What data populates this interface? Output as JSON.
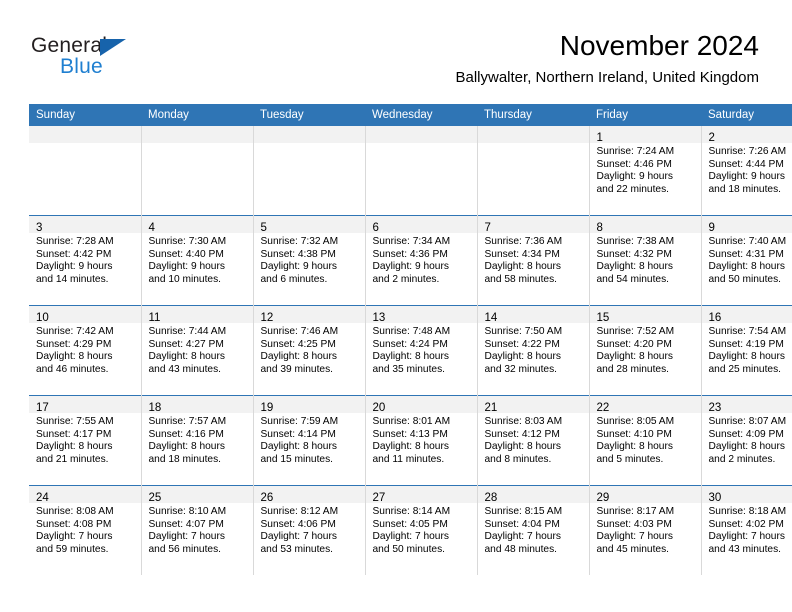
{
  "brand": {
    "name_part1": "General",
    "name_part2": "Blue",
    "accent_color": "#1f7fd0",
    "triangle_color": "#1763ab",
    "logo_icon": "blue-triangle-icon"
  },
  "header": {
    "title": "November 2024",
    "subtitle": "Ballywalter, Northern Ireland, United Kingdom"
  },
  "calendar": {
    "header_bg": "#2f75b5",
    "daynum_band_bg": "#f2f2f2",
    "weekdays": [
      "Sunday",
      "Monday",
      "Tuesday",
      "Wednesday",
      "Thursday",
      "Friday",
      "Saturday"
    ],
    "weeks": [
      [
        {
          "day": "",
          "lines": []
        },
        {
          "day": "",
          "lines": []
        },
        {
          "day": "",
          "lines": []
        },
        {
          "day": "",
          "lines": []
        },
        {
          "day": "",
          "lines": []
        },
        {
          "day": "1",
          "lines": [
            "Sunrise: 7:24 AM",
            "Sunset: 4:46 PM",
            "Daylight: 9 hours",
            "and 22 minutes."
          ]
        },
        {
          "day": "2",
          "lines": [
            "Sunrise: 7:26 AM",
            "Sunset: 4:44 PM",
            "Daylight: 9 hours",
            "and 18 minutes."
          ]
        }
      ],
      [
        {
          "day": "3",
          "lines": [
            "Sunrise: 7:28 AM",
            "Sunset: 4:42 PM",
            "Daylight: 9 hours",
            "and 14 minutes."
          ]
        },
        {
          "day": "4",
          "lines": [
            "Sunrise: 7:30 AM",
            "Sunset: 4:40 PM",
            "Daylight: 9 hours",
            "and 10 minutes."
          ]
        },
        {
          "day": "5",
          "lines": [
            "Sunrise: 7:32 AM",
            "Sunset: 4:38 PM",
            "Daylight: 9 hours",
            "and 6 minutes."
          ]
        },
        {
          "day": "6",
          "lines": [
            "Sunrise: 7:34 AM",
            "Sunset: 4:36 PM",
            "Daylight: 9 hours",
            "and 2 minutes."
          ]
        },
        {
          "day": "7",
          "lines": [
            "Sunrise: 7:36 AM",
            "Sunset: 4:34 PM",
            "Daylight: 8 hours",
            "and 58 minutes."
          ]
        },
        {
          "day": "8",
          "lines": [
            "Sunrise: 7:38 AM",
            "Sunset: 4:32 PM",
            "Daylight: 8 hours",
            "and 54 minutes."
          ]
        },
        {
          "day": "9",
          "lines": [
            "Sunrise: 7:40 AM",
            "Sunset: 4:31 PM",
            "Daylight: 8 hours",
            "and 50 minutes."
          ]
        }
      ],
      [
        {
          "day": "10",
          "lines": [
            "Sunrise: 7:42 AM",
            "Sunset: 4:29 PM",
            "Daylight: 8 hours",
            "and 46 minutes."
          ]
        },
        {
          "day": "11",
          "lines": [
            "Sunrise: 7:44 AM",
            "Sunset: 4:27 PM",
            "Daylight: 8 hours",
            "and 43 minutes."
          ]
        },
        {
          "day": "12",
          "lines": [
            "Sunrise: 7:46 AM",
            "Sunset: 4:25 PM",
            "Daylight: 8 hours",
            "and 39 minutes."
          ]
        },
        {
          "day": "13",
          "lines": [
            "Sunrise: 7:48 AM",
            "Sunset: 4:24 PM",
            "Daylight: 8 hours",
            "and 35 minutes."
          ]
        },
        {
          "day": "14",
          "lines": [
            "Sunrise: 7:50 AM",
            "Sunset: 4:22 PM",
            "Daylight: 8 hours",
            "and 32 minutes."
          ]
        },
        {
          "day": "15",
          "lines": [
            "Sunrise: 7:52 AM",
            "Sunset: 4:20 PM",
            "Daylight: 8 hours",
            "and 28 minutes."
          ]
        },
        {
          "day": "16",
          "lines": [
            "Sunrise: 7:54 AM",
            "Sunset: 4:19 PM",
            "Daylight: 8 hours",
            "and 25 minutes."
          ]
        }
      ],
      [
        {
          "day": "17",
          "lines": [
            "Sunrise: 7:55 AM",
            "Sunset: 4:17 PM",
            "Daylight: 8 hours",
            "and 21 minutes."
          ]
        },
        {
          "day": "18",
          "lines": [
            "Sunrise: 7:57 AM",
            "Sunset: 4:16 PM",
            "Daylight: 8 hours",
            "and 18 minutes."
          ]
        },
        {
          "day": "19",
          "lines": [
            "Sunrise: 7:59 AM",
            "Sunset: 4:14 PM",
            "Daylight: 8 hours",
            "and 15 minutes."
          ]
        },
        {
          "day": "20",
          "lines": [
            "Sunrise: 8:01 AM",
            "Sunset: 4:13 PM",
            "Daylight: 8 hours",
            "and 11 minutes."
          ]
        },
        {
          "day": "21",
          "lines": [
            "Sunrise: 8:03 AM",
            "Sunset: 4:12 PM",
            "Daylight: 8 hours",
            "and 8 minutes."
          ]
        },
        {
          "day": "22",
          "lines": [
            "Sunrise: 8:05 AM",
            "Sunset: 4:10 PM",
            "Daylight: 8 hours",
            "and 5 minutes."
          ]
        },
        {
          "day": "23",
          "lines": [
            "Sunrise: 8:07 AM",
            "Sunset: 4:09 PM",
            "Daylight: 8 hours",
            "and 2 minutes."
          ]
        }
      ],
      [
        {
          "day": "24",
          "lines": [
            "Sunrise: 8:08 AM",
            "Sunset: 4:08 PM",
            "Daylight: 7 hours",
            "and 59 minutes."
          ]
        },
        {
          "day": "25",
          "lines": [
            "Sunrise: 8:10 AM",
            "Sunset: 4:07 PM",
            "Daylight: 7 hours",
            "and 56 minutes."
          ]
        },
        {
          "day": "26",
          "lines": [
            "Sunrise: 8:12 AM",
            "Sunset: 4:06 PM",
            "Daylight: 7 hours",
            "and 53 minutes."
          ]
        },
        {
          "day": "27",
          "lines": [
            "Sunrise: 8:14 AM",
            "Sunset: 4:05 PM",
            "Daylight: 7 hours",
            "and 50 minutes."
          ]
        },
        {
          "day": "28",
          "lines": [
            "Sunrise: 8:15 AM",
            "Sunset: 4:04 PM",
            "Daylight: 7 hours",
            "and 48 minutes."
          ]
        },
        {
          "day": "29",
          "lines": [
            "Sunrise: 8:17 AM",
            "Sunset: 4:03 PM",
            "Daylight: 7 hours",
            "and 45 minutes."
          ]
        },
        {
          "day": "30",
          "lines": [
            "Sunrise: 8:18 AM",
            "Sunset: 4:02 PM",
            "Daylight: 7 hours",
            "and 43 minutes."
          ]
        }
      ]
    ]
  }
}
